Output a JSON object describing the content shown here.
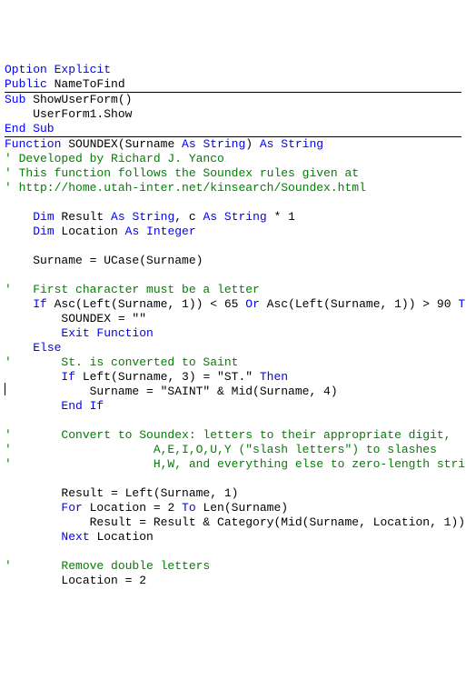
{
  "lines": [
    {
      "segments": [
        {
          "cls": "kw",
          "t": "Option Explicit"
        }
      ]
    },
    {
      "segments": [
        {
          "cls": "kw",
          "t": "Public"
        },
        {
          "cls": "txt",
          "t": " NameToFind"
        }
      ]
    },
    {
      "hr": true
    },
    {
      "segments": [
        {
          "cls": "kw",
          "t": "Sub"
        },
        {
          "cls": "txt",
          "t": " ShowUserForm()"
        }
      ]
    },
    {
      "segments": [
        {
          "cls": "txt",
          "t": "    UserForm1.Show"
        }
      ]
    },
    {
      "segments": [
        {
          "cls": "kw",
          "t": "End Sub"
        }
      ]
    },
    {
      "hr": true
    },
    {
      "segments": [
        {
          "cls": "kw",
          "t": "Function"
        },
        {
          "cls": "txt",
          "t": " SOUNDEX(Surname "
        },
        {
          "cls": "kw",
          "t": "As String"
        },
        {
          "cls": "txt",
          "t": ") "
        },
        {
          "cls": "kw",
          "t": "As String"
        }
      ]
    },
    {
      "segments": [
        {
          "cls": "comment",
          "t": "' Developed by Richard J. Yanco"
        }
      ]
    },
    {
      "segments": [
        {
          "cls": "comment",
          "t": "' This function follows the Soundex rules given at"
        }
      ]
    },
    {
      "segments": [
        {
          "cls": "comment",
          "t": "' http://home.utah-inter.net/kinsearch/Soundex.html"
        }
      ]
    },
    {
      "segments": [
        {
          "cls": "txt",
          "t": ""
        }
      ]
    },
    {
      "segments": [
        {
          "cls": "txt",
          "t": "    "
        },
        {
          "cls": "kw",
          "t": "Dim"
        },
        {
          "cls": "txt",
          "t": " Result "
        },
        {
          "cls": "kw",
          "t": "As String"
        },
        {
          "cls": "txt",
          "t": ", c "
        },
        {
          "cls": "kw",
          "t": "As String"
        },
        {
          "cls": "txt",
          "t": " * 1"
        }
      ]
    },
    {
      "segments": [
        {
          "cls": "txt",
          "t": "    "
        },
        {
          "cls": "kw",
          "t": "Dim"
        },
        {
          "cls": "txt",
          "t": " Location "
        },
        {
          "cls": "kw",
          "t": "As Integer"
        }
      ]
    },
    {
      "segments": [
        {
          "cls": "txt",
          "t": ""
        }
      ]
    },
    {
      "segments": [
        {
          "cls": "txt",
          "t": "    Surname = UCase(Surname)"
        }
      ]
    },
    {
      "segments": [
        {
          "cls": "txt",
          "t": ""
        }
      ]
    },
    {
      "segments": [
        {
          "cls": "comment",
          "t": "'   First character must be a letter"
        }
      ]
    },
    {
      "segments": [
        {
          "cls": "txt",
          "t": "    "
        },
        {
          "cls": "kw",
          "t": "If"
        },
        {
          "cls": "txt",
          "t": " Asc(Left(Surname, 1)) < 65 "
        },
        {
          "cls": "kw",
          "t": "Or"
        },
        {
          "cls": "txt",
          "t": " Asc(Left(Surname, 1)) > 90 "
        },
        {
          "cls": "kw",
          "t": "Then"
        }
      ]
    },
    {
      "segments": [
        {
          "cls": "txt",
          "t": "        SOUNDEX = \"\""
        }
      ]
    },
    {
      "segments": [
        {
          "cls": "txt",
          "t": "        "
        },
        {
          "cls": "kw",
          "t": "Exit Function"
        }
      ]
    },
    {
      "segments": [
        {
          "cls": "txt",
          "t": "    "
        },
        {
          "cls": "kw",
          "t": "Else"
        }
      ]
    },
    {
      "segments": [
        {
          "cls": "comment",
          "t": "'       St. is converted to Saint"
        }
      ]
    },
    {
      "segments": [
        {
          "cls": "txt",
          "t": "        "
        },
        {
          "cls": "kw",
          "t": "If"
        },
        {
          "cls": "txt",
          "t": " Left(Surname, 3) = \"ST.\" "
        },
        {
          "cls": "kw",
          "t": "Then"
        }
      ]
    },
    {
      "segments": [
        {
          "cls": "txt",
          "t": "            Surname = \"SAINT\" & Mid(Surname, 4)"
        }
      ]
    },
    {
      "segments": [
        {
          "cls": "txt",
          "t": "        "
        },
        {
          "cls": "kw",
          "t": "End If"
        }
      ]
    },
    {
      "segments": [
        {
          "cls": "txt",
          "t": ""
        }
      ]
    },
    {
      "segments": [
        {
          "cls": "comment",
          "t": "'       Convert to Soundex: letters to their appropriate digit,"
        }
      ]
    },
    {
      "segments": [
        {
          "cls": "comment",
          "t": "'                    A,E,I,O,U,Y (\"slash letters\") to slashes"
        }
      ]
    },
    {
      "segments": [
        {
          "cls": "comment",
          "t": "'                    H,W, and everything else to zero-length string"
        }
      ]
    },
    {
      "segments": [
        {
          "cls": "txt",
          "t": ""
        }
      ]
    },
    {
      "segments": [
        {
          "cls": "txt",
          "t": "        Result = Left(Surname, 1)"
        }
      ]
    },
    {
      "segments": [
        {
          "cls": "txt",
          "t": "        "
        },
        {
          "cls": "kw",
          "t": "For"
        },
        {
          "cls": "txt",
          "t": " Location = 2 "
        },
        {
          "cls": "kw",
          "t": "To"
        },
        {
          "cls": "txt",
          "t": " Len(Surname)"
        }
      ]
    },
    {
      "segments": [
        {
          "cls": "txt",
          "t": "            Result = Result & Category(Mid(Surname, Location, 1))"
        }
      ]
    },
    {
      "segments": [
        {
          "cls": "txt",
          "t": "        "
        },
        {
          "cls": "kw",
          "t": "Next"
        },
        {
          "cls": "txt",
          "t": " Location"
        }
      ]
    },
    {
      "segments": [
        {
          "cls": "txt",
          "t": ""
        }
      ]
    },
    {
      "segments": [
        {
          "cls": "comment",
          "t": "'       Remove double letters"
        }
      ]
    },
    {
      "segments": [
        {
          "cls": "txt",
          "t": "        Location = 2"
        }
      ]
    }
  ]
}
